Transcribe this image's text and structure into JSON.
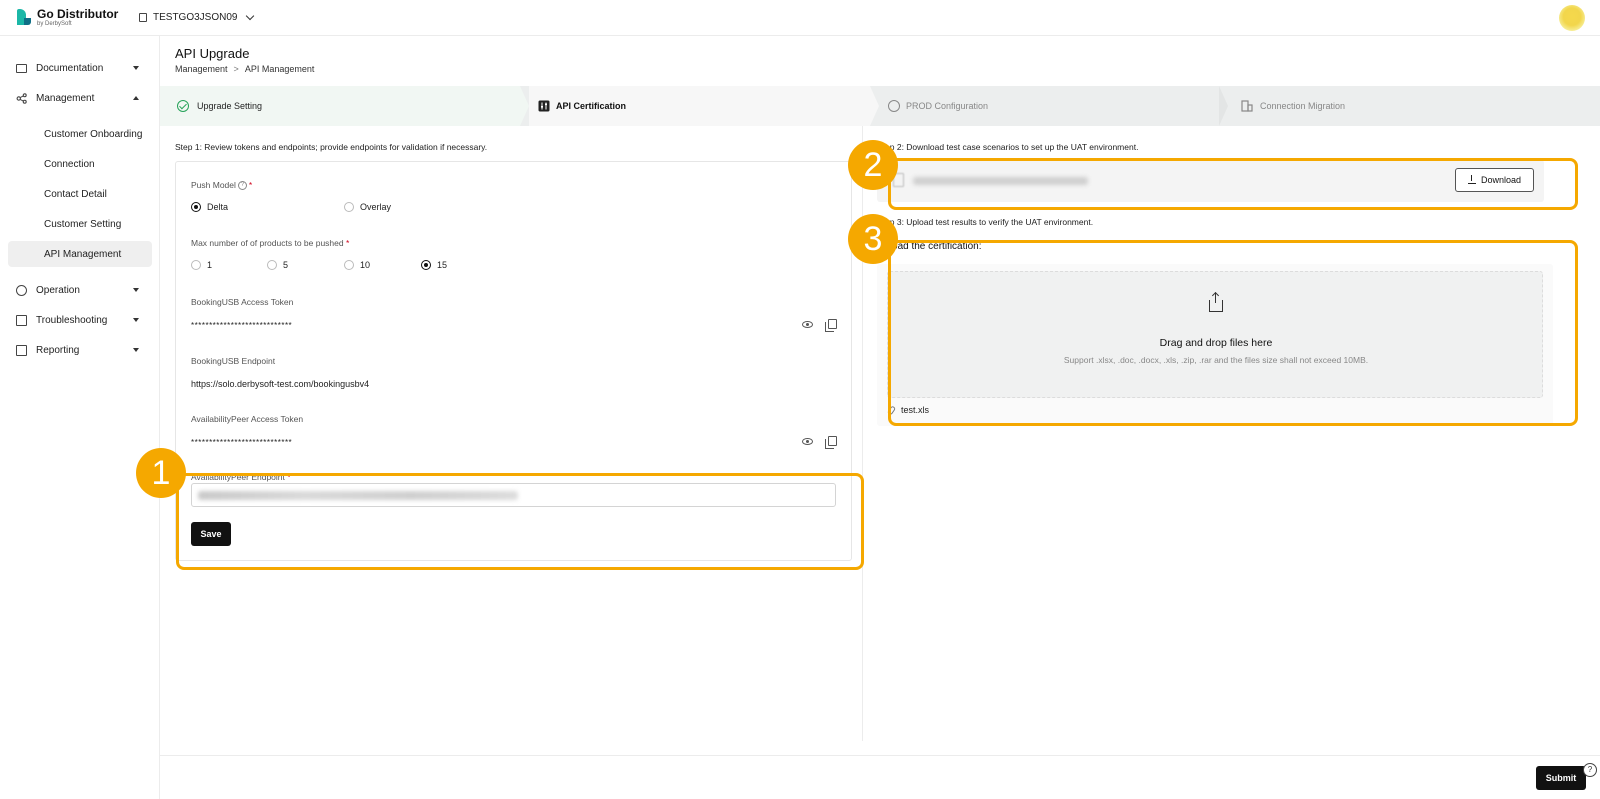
{
  "app": {
    "brand": "Go Distributor",
    "brand_sub": "by DerbySoft",
    "tenant": "TESTGO3JSON09"
  },
  "sidebar": {
    "items": [
      {
        "label": "Documentation",
        "icon": "folder-icon"
      },
      {
        "label": "Management",
        "icon": "share-icon"
      },
      {
        "label": "Operation",
        "icon": "gear-icon"
      },
      {
        "label": "Troubleshooting",
        "icon": "calendar-icon"
      },
      {
        "label": "Reporting",
        "icon": "report-icon"
      }
    ],
    "sub_items": [
      {
        "label": "Customer Onboarding"
      },
      {
        "label": "Connection"
      },
      {
        "label": "Contact Detail"
      },
      {
        "label": "Customer Setting"
      },
      {
        "label": "API Management",
        "active": true
      }
    ]
  },
  "page": {
    "title": "API Upgrade",
    "breadcrumb": [
      "Management",
      "API Management"
    ],
    "breadcrumb_sep": ">"
  },
  "steps": [
    {
      "label": "Upgrade Setting",
      "status": "done"
    },
    {
      "label": "API Certification",
      "status": "current"
    },
    {
      "label": "PROD Configuration",
      "status": "pending"
    },
    {
      "label": "Connection Migration",
      "status": "pending"
    }
  ],
  "left": {
    "step_text": "Step 1: Review tokens and endpoints; provide endpoints for validation if necessary.",
    "push_model": {
      "label": "Push Model",
      "required": "*",
      "options": [
        "Delta",
        "Overlay"
      ],
      "selected": "Delta"
    },
    "max_products": {
      "label": "Max number of of products to be pushed",
      "required": "*",
      "options": [
        "1",
        "5",
        "10",
        "15"
      ],
      "selected": "15"
    },
    "booking_token": {
      "label": "BookingUSB Access Token",
      "value": "****************************"
    },
    "booking_endpoint": {
      "label": "BookingUSB Endpoint",
      "value": "https://solo.derbysoft-test.com/bookingusbv4"
    },
    "avail_token": {
      "label": "AvailabilityPeer Access Token",
      "value": "****************************"
    },
    "avail_endpoint": {
      "label": "AvailabilityPeer Endpoint",
      "required": "*"
    },
    "save_label": "Save"
  },
  "right": {
    "step2_text": "Step 2: Download test case scenarios to set up the UAT environment.",
    "download_label": "Download",
    "step3_text": "Step 3: Upload test results to verify the UAT environment.",
    "upload_title": "Upload the certification:",
    "drop_main": "Drag and drop files here",
    "drop_sub": "Support .xlsx, .doc, .docx, .xls, .zip, .rar and the files size shall not exceed 10MB.",
    "uploaded_file": "test.xls"
  },
  "callouts": [
    "1",
    "2",
    "3"
  ],
  "footer": {
    "submit_label": "Submit",
    "help": "?"
  },
  "colors": {
    "highlight": "#f5a800",
    "primary": "#111111",
    "success": "#27a35a",
    "brand_teal": "#1bb7a7"
  }
}
